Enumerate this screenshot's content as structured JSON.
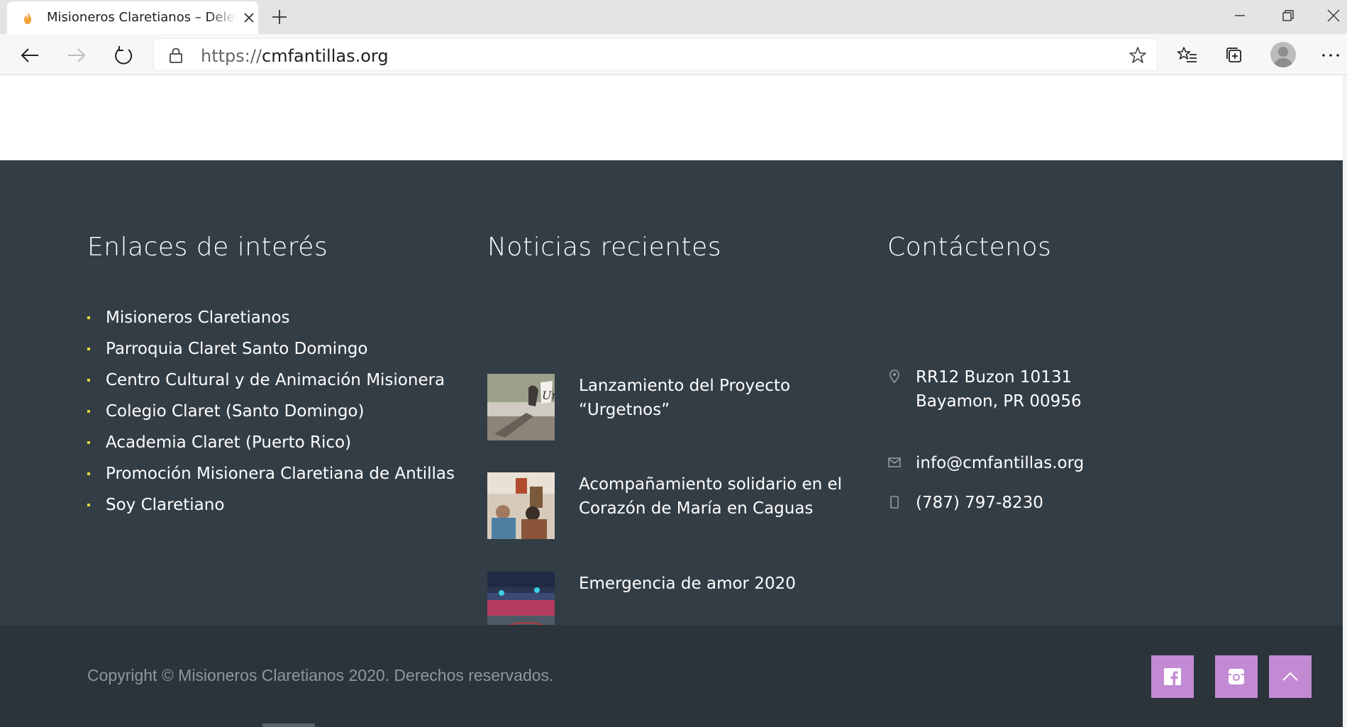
{
  "browser": {
    "tab_title": "Misioneros Claretianos – Delegación",
    "url_scheme": "https://",
    "url_host": "cmfantillas.org"
  },
  "footer": {
    "links_heading": "Enlaces de interés",
    "links": [
      "Misioneros Claretianos",
      "Parroquia Claret Santo Domingo",
      "Centro Cultural y de Animación Misionera",
      "Colegio Claret (Santo Domingo)",
      "Academia Claret (Puerto Rico)",
      "Promoción Misionera Claretiana de Antillas",
      "Soy Claretiano"
    ],
    "news_heading": "Noticias recientes",
    "news": [
      {
        "title": "Lanzamiento del Proyecto “Urgetnos”"
      },
      {
        "title": "Acompañamiento solidario en el Corazón de María en Caguas"
      },
      {
        "title": "Emergencia de amor 2020"
      }
    ],
    "contact_heading": "Contáctenos",
    "contact": {
      "address_line1": "RR12 Buzon 10131",
      "address_line2": "Bayamon, PR 00956",
      "email": "info@cmfantillas.org",
      "phone": "(787) 797-8230"
    },
    "copyright": "Copyright © Misioneros Claretianos 2020. Derechos reservados.",
    "social_icons": [
      "facebook-icon",
      "instagram-icon",
      "chevron-up-icon"
    ]
  },
  "colors": {
    "footer_bg": "#333d45",
    "footer_bottom_bg": "#2b343b",
    "accent": "#c38ad4",
    "bullet": "#e6d63a"
  }
}
